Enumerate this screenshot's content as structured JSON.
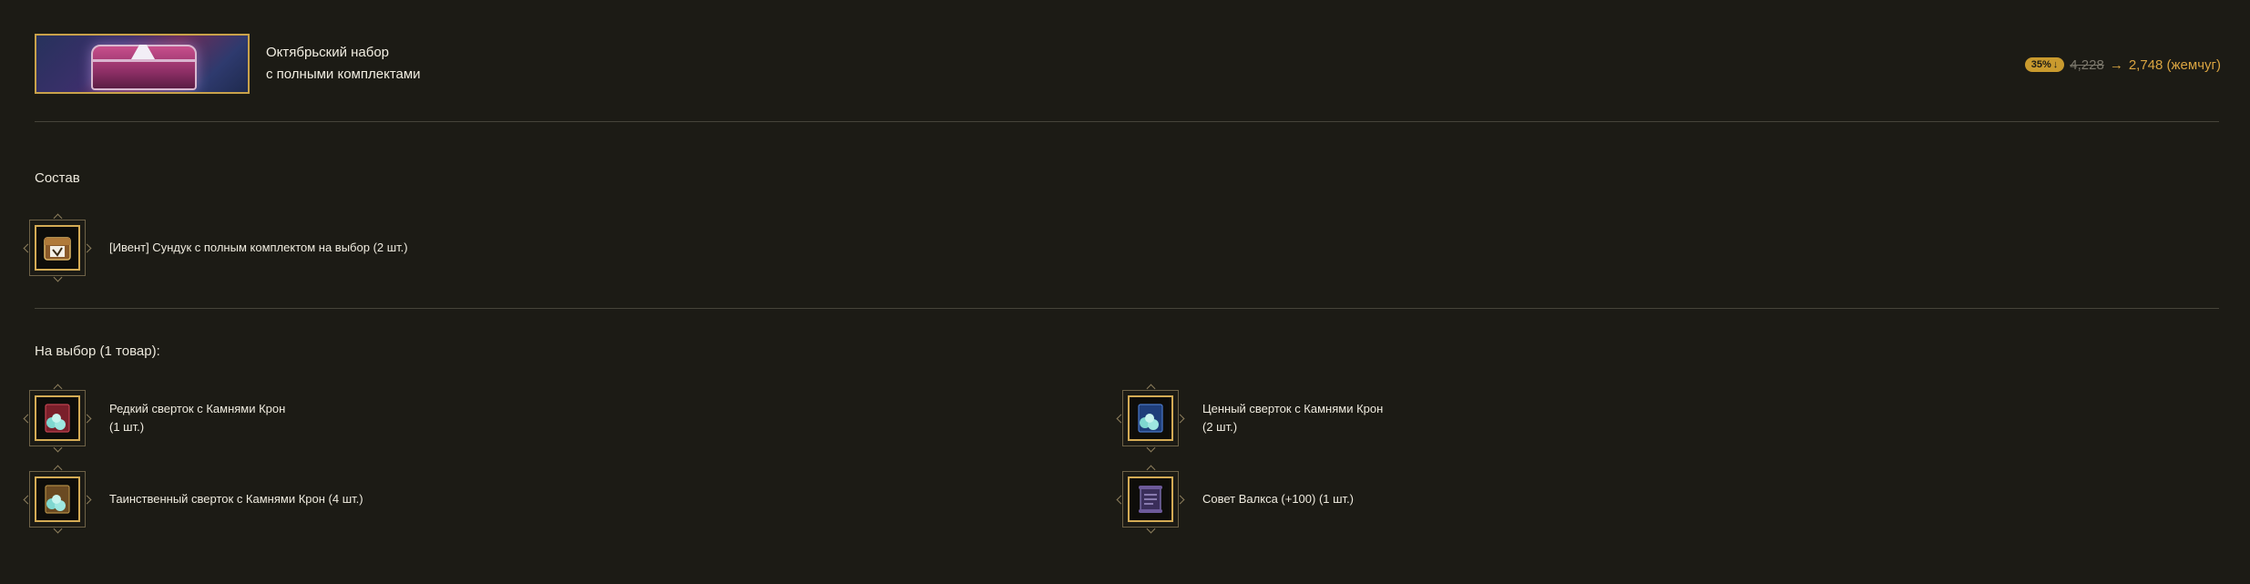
{
  "header": {
    "title_line1": "Октябрьский набор",
    "title_line2": "с полными комплектами",
    "discount_badge": "35%",
    "discount_arrow": "↓",
    "old_price": "4,228",
    "arrow": "→",
    "new_price": "2,748 (жемчуг)"
  },
  "composition": {
    "title": "Состав",
    "items": [
      {
        "label": "[Ивент] Сундук с полным комплектом на выбор (2 шт.)",
        "icon": "chest-icon"
      }
    ]
  },
  "choice": {
    "title": "На выбор (1 товар):",
    "items": [
      {
        "line1": "Редкий сверток с Камнями Крон",
        "line2": "(1 шт.)",
        "icon": "red-bundle-icon"
      },
      {
        "line1": "Ценный сверток с Камнями Крон",
        "line2": "(2 шт.)",
        "icon": "blue-bundle-icon"
      },
      {
        "line1": "Таинственный сверток с Камнями Крон (4 шт.)",
        "icon": "brown-bundle-icon"
      },
      {
        "line1": "Совет Валкса (+100) (1 шт.)",
        "icon": "scroll-icon"
      }
    ]
  },
  "colors": {
    "background": "#1c1b15",
    "gold": "#d4ab55",
    "price": "#d9a441",
    "badge": "#c99a2e"
  }
}
